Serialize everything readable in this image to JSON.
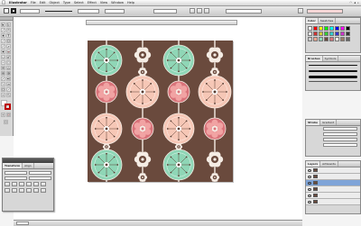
{
  "menubar": {
    "apple": "",
    "items": [
      "Illustrator",
      "File",
      "Edit",
      "Object",
      "Type",
      "Select",
      "Effect",
      "View",
      "Window",
      "Help"
    ]
  },
  "document": {
    "tab_title": ""
  },
  "panels": {
    "swatches_tabs": [
      "Color",
      "Swatches"
    ],
    "brushes_tabs": [
      "Brushes",
      "Symbols"
    ],
    "stroke_tabs": [
      "Stroke",
      "Gradient"
    ],
    "layers_tabs": [
      "Layers",
      "Artboards"
    ],
    "float_tabs": [
      "Transform",
      "Align"
    ]
  },
  "pattern": {
    "background": "#6a4a3d",
    "mint": "#8fd6b6",
    "peach": "#f6c7b6",
    "rose": "#d9737a",
    "cream": "#f5ece4",
    "line": "#f5ece4"
  },
  "colors": {
    "swatches": [
      "#ffffff",
      "#ff0000",
      "#ffff00",
      "#00ff00",
      "#00ffff",
      "#0000ff",
      "#ff00ff",
      "#000000",
      "#e6e6e6",
      "#cc3333",
      "#cccc33",
      "#33cc33",
      "#33cccc",
      "#3333cc",
      "#cc33cc",
      "#333333",
      "#cccccc",
      "#f2a38b",
      "#8fd6b6",
      "#6a4a3d",
      "#d9737a",
      "#f5ece4",
      "#9b7b6a",
      "#666666"
    ]
  }
}
